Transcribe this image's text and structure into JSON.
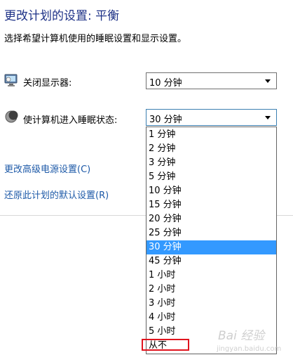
{
  "header": {
    "title": "更改计划的设置: 平衡",
    "subtitle": "选择希望计算机使用的睡眠设置和显示设置。"
  },
  "settings": {
    "display": {
      "label": "关闭显示器:",
      "value": "10 分钟",
      "icon": "monitor-icon"
    },
    "sleep": {
      "label": "使计算机进入睡眠状态:",
      "value": "30 分钟",
      "icon": "moon-icon"
    }
  },
  "links": {
    "advanced": "更改高级电源设置(C)",
    "restore": "还原此计划的默认设置(R)"
  },
  "dropdown": {
    "options": [
      "1 分钟",
      "2 分钟",
      "3 分钟",
      "5 分钟",
      "10 分钟",
      "15 分钟",
      "20 分钟",
      "25 分钟",
      "30 分钟",
      "45 分钟",
      "1 小时",
      "2 小时",
      "3 小时",
      "4 小时",
      "5 小时",
      "从不"
    ],
    "selected_index": 8
  },
  "watermark": {
    "brand": "Bai 经验",
    "url": "jingyan.baidu.com"
  },
  "colors": {
    "title": "#1e3287",
    "link": "#1e5aa8",
    "selection": "#3399ff",
    "highlight_box": "#e0141e"
  }
}
